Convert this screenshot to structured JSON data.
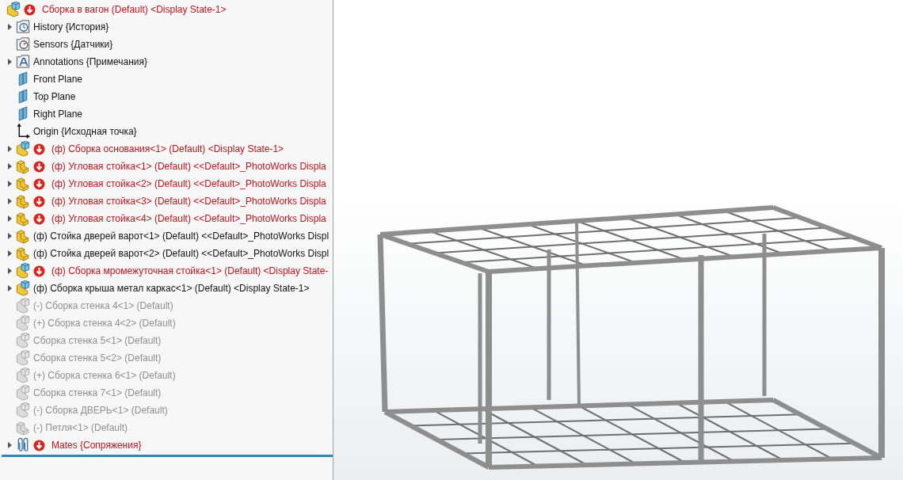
{
  "feature_tree": {
    "root": {
      "label": "Сборка в вагон (Default) <Display State-1>",
      "kind": "assembly",
      "error": true,
      "suppressed": false,
      "children": [
        {
          "label": "History {История}",
          "kind": "history",
          "error": false,
          "suppressed": false,
          "expandable": true
        },
        {
          "label": "Sensors {Датчики}",
          "kind": "sensors",
          "error": false,
          "suppressed": false,
          "expandable": false
        },
        {
          "label": "Annotations {Примечания}",
          "kind": "annotations",
          "error": false,
          "suppressed": false,
          "expandable": true
        },
        {
          "label": "Front Plane",
          "kind": "plane",
          "error": false,
          "suppressed": false,
          "expandable": false
        },
        {
          "label": "Top Plane",
          "kind": "plane",
          "error": false,
          "suppressed": false,
          "expandable": false
        },
        {
          "label": "Right Plane",
          "kind": "plane",
          "error": false,
          "suppressed": false,
          "expandable": false
        },
        {
          "label": "Origin {Исходная точка}",
          "kind": "origin",
          "error": false,
          "suppressed": false,
          "expandable": false
        },
        {
          "label": "(ф) Сборка основания<1> (Default) <Display State-1>",
          "kind": "assembly",
          "error": true,
          "suppressed": false,
          "expandable": true
        },
        {
          "label": "(ф) Угловая стойка<1> (Default) <<Default>_PhotoWorks Displa",
          "kind": "part",
          "error": true,
          "suppressed": false,
          "expandable": true
        },
        {
          "label": "(ф) Угловая стойка<2> (Default) <<Default>_PhotoWorks Displa",
          "kind": "part",
          "error": true,
          "suppressed": false,
          "expandable": true
        },
        {
          "label": "(ф) Угловая стойка<3> (Default) <<Default>_PhotoWorks Displa",
          "kind": "part",
          "error": true,
          "suppressed": false,
          "expandable": true
        },
        {
          "label": "(ф) Угловая стойка<4> (Default) <<Default>_PhotoWorks Displa",
          "kind": "part",
          "error": true,
          "suppressed": false,
          "expandable": true
        },
        {
          "label": "(ф) Стойка дверей варот<1> (Default) <<Default>_PhotoWorks Displ",
          "kind": "part",
          "error": false,
          "suppressed": false,
          "expandable": true
        },
        {
          "label": "(ф) Стойка дверей варот<2> (Default) <<Default>_PhotoWorks Displ",
          "kind": "part",
          "error": false,
          "suppressed": false,
          "expandable": true
        },
        {
          "label": "(ф) Сборка мромежуточная стойка<1> (Default) <Display State-",
          "kind": "assembly",
          "error": true,
          "suppressed": false,
          "expandable": true
        },
        {
          "label": "(ф) Сборка крыша метал каркас<1> (Default) <Display State-1>",
          "kind": "assembly",
          "error": false,
          "suppressed": false,
          "expandable": true
        },
        {
          "label": "(-) Сборка стенка 4<1> (Default)",
          "kind": "assembly",
          "error": false,
          "suppressed": true,
          "expandable": false
        },
        {
          "label": "(+) Сборка стенка 4<2> (Default)",
          "kind": "assembly",
          "error": false,
          "suppressed": true,
          "expandable": false
        },
        {
          "label": "Сборка стенка 5<1> (Default)",
          "kind": "assembly",
          "error": false,
          "suppressed": true,
          "expandable": false
        },
        {
          "label": "Сборка стенка 5<2> (Default)",
          "kind": "assembly",
          "error": false,
          "suppressed": true,
          "expandable": false
        },
        {
          "label": "(+) Сборка стенка 6<1> (Default)",
          "kind": "assembly",
          "error": false,
          "suppressed": true,
          "expandable": false
        },
        {
          "label": "Сборка стенка 7<1> (Default)",
          "kind": "assembly",
          "error": false,
          "suppressed": true,
          "expandable": false
        },
        {
          "label": "(-) Сборка ДВЕРЬ<1> (Default)",
          "kind": "assembly",
          "error": false,
          "suppressed": true,
          "expandable": false
        },
        {
          "label": "(-) Петля<1> (Default)",
          "kind": "part",
          "error": false,
          "suppressed": true,
          "expandable": false
        },
        {
          "label": "Mates {Сопряжения}",
          "kind": "mates",
          "error": true,
          "suppressed": false,
          "expandable": true
        }
      ]
    }
  }
}
